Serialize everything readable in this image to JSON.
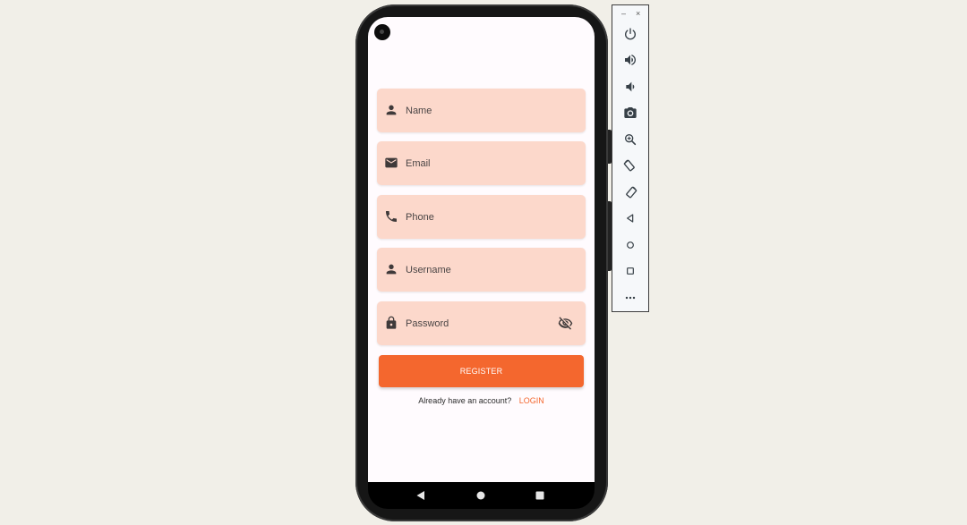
{
  "form": {
    "name_placeholder": "Name",
    "email_placeholder": "Email",
    "phone_placeholder": "Phone",
    "username_placeholder": "Username",
    "password_placeholder": "Password",
    "register_label": "REGISTER",
    "login_prompt": "Already have an account?",
    "login_label": "LOGIN"
  },
  "icons": {
    "name": "person-icon",
    "email": "mail-icon",
    "phone": "phone-icon",
    "username": "person-icon",
    "password": "lock-icon",
    "visibility": "visibility-off-icon"
  },
  "nav": {
    "items": [
      "back-icon",
      "home-icon",
      "recents-icon"
    ]
  },
  "toolbar": {
    "window_controls": [
      "–",
      "×"
    ],
    "buttons": [
      "power-icon",
      "volume-up-icon",
      "volume-down-icon",
      "camera-icon",
      "zoom-icon",
      "rotate-left-icon",
      "rotate-right-icon",
      "back-icon",
      "home-icon",
      "overview-icon",
      "more-icon"
    ]
  },
  "colors": {
    "accent": "#f4672e",
    "field_fill": "#fcd8cb",
    "screen_bg": "#fffbfe",
    "page_bg": "#f1efe8"
  }
}
